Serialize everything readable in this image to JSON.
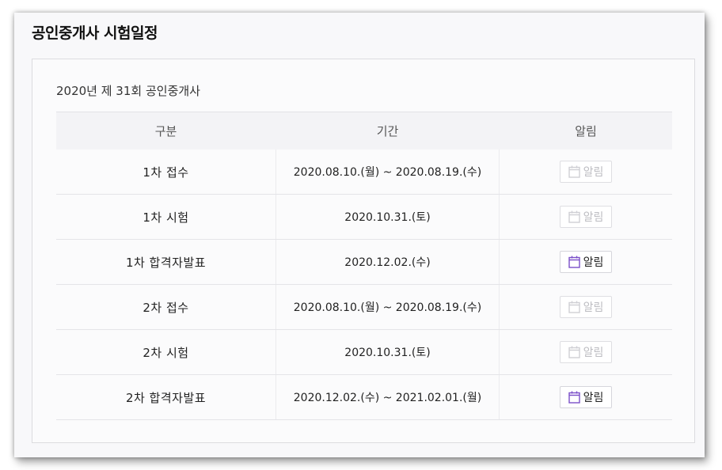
{
  "page": {
    "title": "공인중개사 시험일정"
  },
  "exam": {
    "title": "2020년 제 31회 공인중개사"
  },
  "table": {
    "headers": [
      "구분",
      "기간",
      "알림"
    ],
    "rows": [
      {
        "name": "1차 접수",
        "period": "2020.08.10.(월) ~ 2020.08.19.(수)",
        "alarm_label": "알림",
        "alarm_active": false
      },
      {
        "name": "1차 시험",
        "period": "2020.10.31.(토)",
        "alarm_label": "알림",
        "alarm_active": false
      },
      {
        "name": "1차 합격자발표",
        "period": "2020.12.02.(수)",
        "alarm_label": "알림",
        "alarm_active": true
      },
      {
        "name": "2차 접수",
        "period": "2020.08.10.(월) ~ 2020.08.19.(수)",
        "alarm_label": "알림",
        "alarm_active": false
      },
      {
        "name": "2차 시험",
        "period": "2020.10.31.(토)",
        "alarm_label": "알림",
        "alarm_active": false
      },
      {
        "name": "2차 합격자발표",
        "period": "2020.12.02.(수) ~ 2021.02.01.(월)",
        "alarm_label": "알림",
        "alarm_active": true
      }
    ]
  },
  "icons": {
    "alarm": "calendar-icon"
  },
  "colors": {
    "calendar_active": "#7b4fc9",
    "calendar_disabled": "#cfcfd4"
  }
}
